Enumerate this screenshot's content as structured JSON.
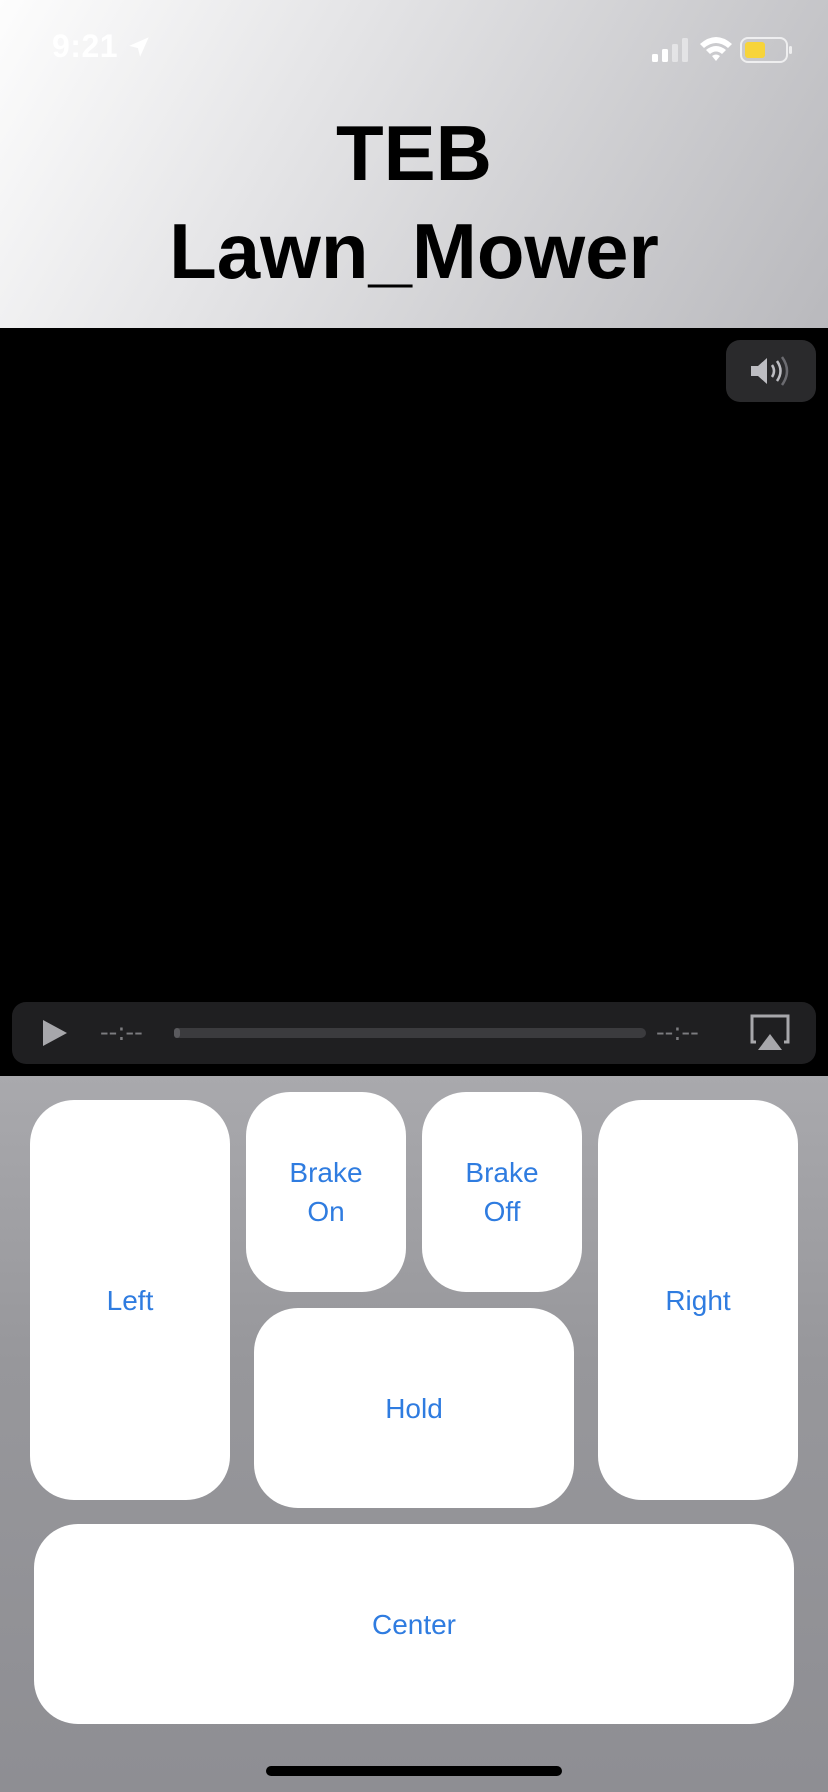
{
  "status_bar": {
    "time": "9:21",
    "location_icon": "location-arrow-icon",
    "signal_icon": "cellular-signal-icon",
    "wifi_icon": "wifi-icon",
    "battery_icon": "battery-low-power-icon",
    "battery_color": "#f7d43a"
  },
  "header": {
    "title_line1": "TEB",
    "title_line2": "Lawn_Mower"
  },
  "video_player": {
    "volume_icon": "speaker-volume-icon",
    "play_icon": "play-icon",
    "time_elapsed": "--:--",
    "time_remaining": "--:--",
    "progress": 0,
    "airplay_icon": "airplay-icon"
  },
  "controls": {
    "left": "Left",
    "brake_on_line1": "Brake",
    "brake_on_line2": "On",
    "brake_off_line1": "Brake",
    "brake_off_line2": "Off",
    "right": "Right",
    "hold": "Hold",
    "center": "Center"
  },
  "colors": {
    "button_text": "#2f7ce0",
    "button_bg": "#ffffff",
    "panel_bg": "#8e8e93"
  }
}
